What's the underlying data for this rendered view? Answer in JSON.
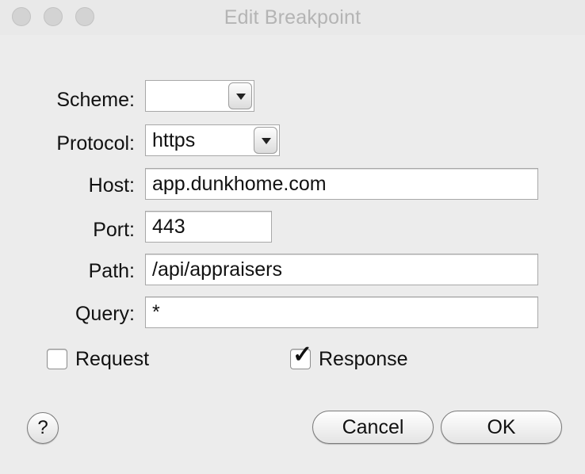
{
  "window": {
    "title": "Edit Breakpoint"
  },
  "form": {
    "scheme": {
      "label": "Scheme:",
      "value": ""
    },
    "protocol": {
      "label": "Protocol:",
      "value": "https"
    },
    "host": {
      "label": "Host:",
      "value": "app.dunkhome.com"
    },
    "port": {
      "label": "Port:",
      "value": "443"
    },
    "path": {
      "label": "Path:",
      "value": "/api/appraisers"
    },
    "query": {
      "label": "Query:",
      "value": "*"
    }
  },
  "options": {
    "request": {
      "label": "Request",
      "checked": false
    },
    "response": {
      "label": "Response",
      "checked": true,
      "mark": "✓"
    }
  },
  "buttons": {
    "help": "?",
    "cancel": "Cancel",
    "ok": "OK"
  }
}
